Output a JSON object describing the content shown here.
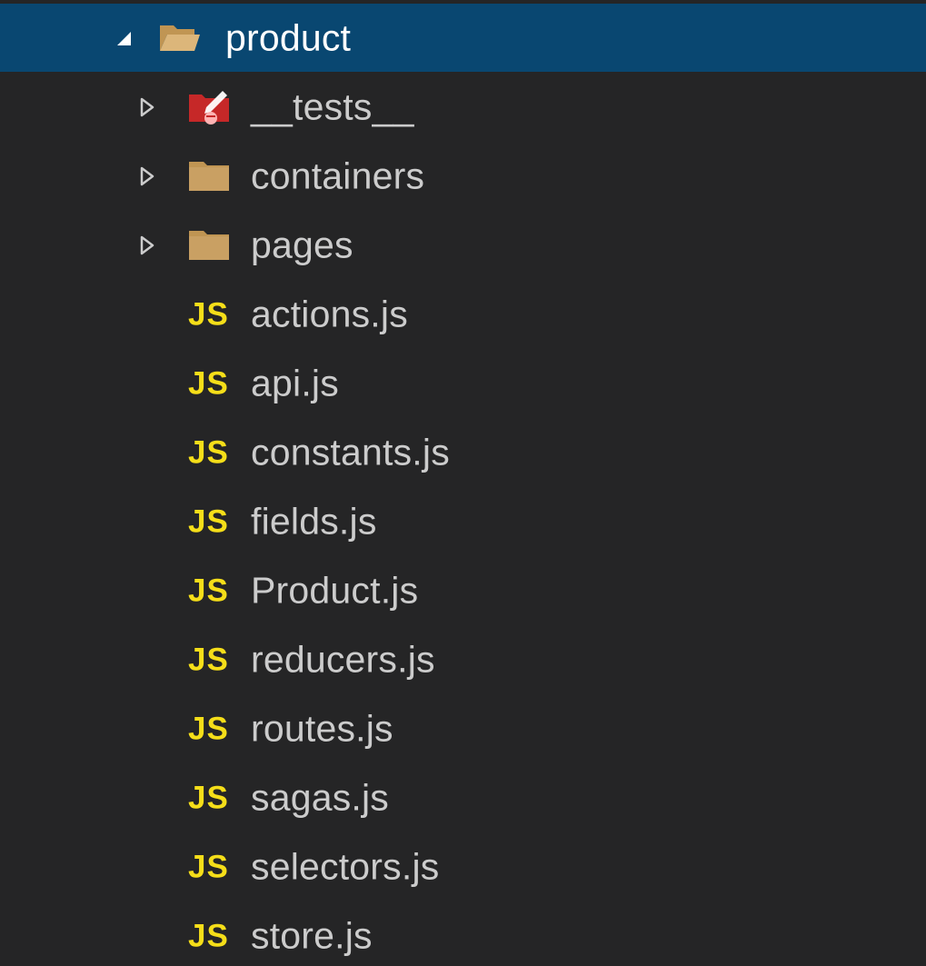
{
  "explorer": {
    "root": {
      "label": "product",
      "icon": "folder-open-icon",
      "expanded": true,
      "selected": true
    },
    "folders": [
      {
        "label": "__tests__",
        "icon": "tests-folder-icon",
        "expanded": false
      },
      {
        "label": "containers",
        "icon": "folder-icon",
        "expanded": false
      },
      {
        "label": "pages",
        "icon": "folder-icon",
        "expanded": false
      }
    ],
    "files": [
      {
        "label": "actions.js",
        "icon_text": "JS"
      },
      {
        "label": "api.js",
        "icon_text": "JS"
      },
      {
        "label": "constants.js",
        "icon_text": "JS"
      },
      {
        "label": "fields.js",
        "icon_text": "JS"
      },
      {
        "label": "Product.js",
        "icon_text": "JS"
      },
      {
        "label": "reducers.js",
        "icon_text": "JS"
      },
      {
        "label": "routes.js",
        "icon_text": "JS"
      },
      {
        "label": "sagas.js",
        "icon_text": "JS"
      },
      {
        "label": "selectors.js",
        "icon_text": "JS"
      },
      {
        "label": "store.js",
        "icon_text": "JS"
      }
    ]
  },
  "colors": {
    "background": "#252526",
    "selection": "#094771",
    "folder": "#c09553",
    "tests_folder": "#c62828",
    "js_icon": "#f5de19",
    "text": "#cccccc"
  }
}
